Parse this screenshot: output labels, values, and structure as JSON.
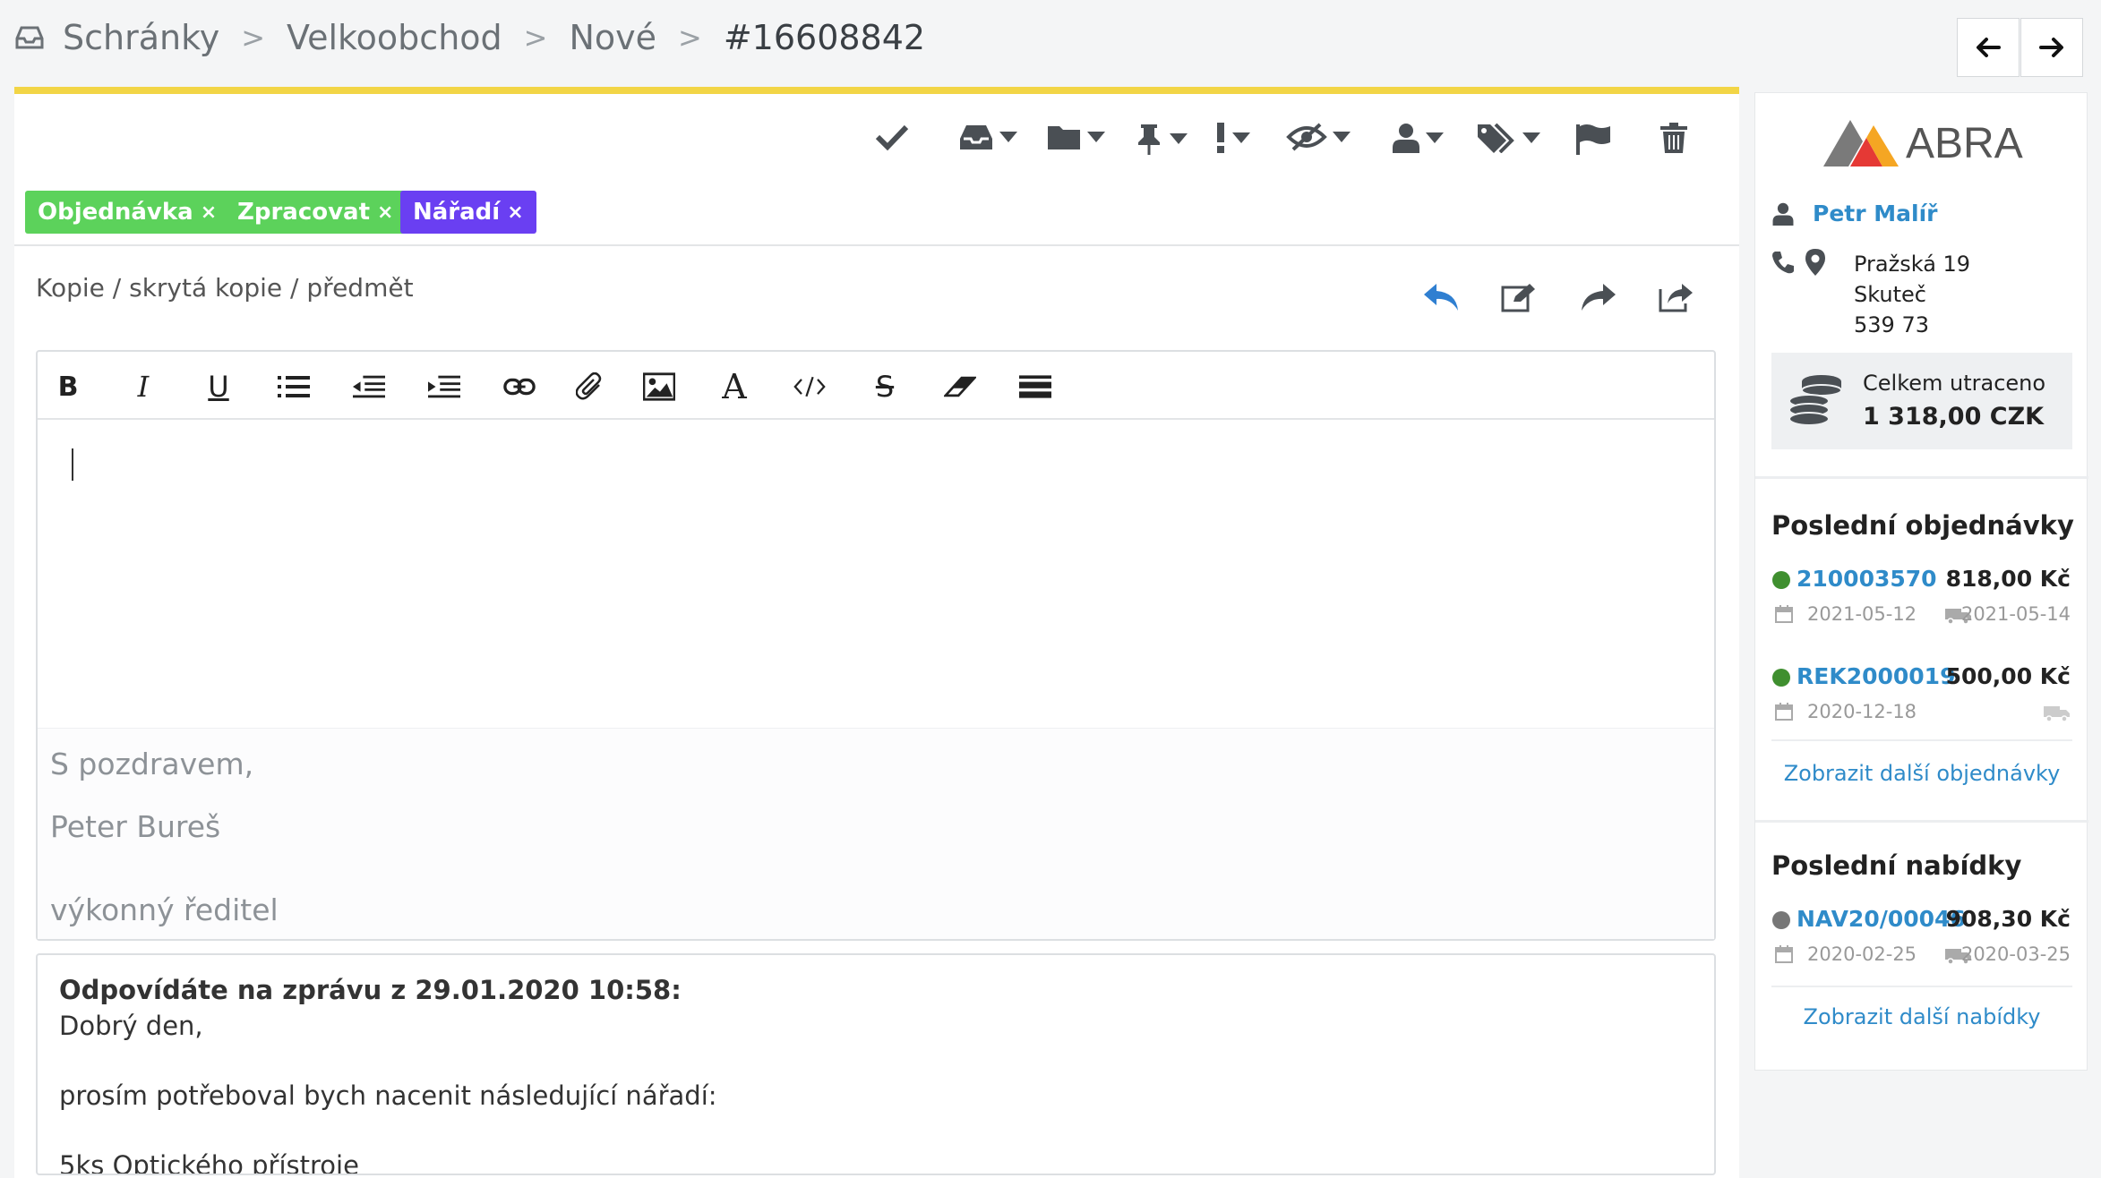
{
  "breadcrumb": {
    "items": [
      "Schránky",
      "Velkoobchod",
      "Nové"
    ],
    "separator": ">",
    "current": "#16608842"
  },
  "navigation": {
    "prev_icon": "arrow-left-icon",
    "next_icon": "arrow-right-icon"
  },
  "toolbar": {
    "icons": [
      "check-icon",
      "inbox-icon",
      "folder-icon",
      "pin-icon",
      "priority-icon",
      "visibility-icon",
      "user-icon",
      "tags-icon",
      "flag-icon",
      "trash-icon"
    ]
  },
  "tags": [
    {
      "label": "Objednávka",
      "color": "#5cd25b"
    },
    {
      "label": "Zpracovat",
      "color": "#5cd25b"
    },
    {
      "label": "Nářadí",
      "color": "#6a3ff2"
    }
  ],
  "tag_remove_symbol": "×",
  "compose": {
    "cc_link": "Kopie / skrytá kopie / předmět",
    "actions": [
      "reply-icon",
      "edit-icon",
      "forward-icon",
      "share-icon"
    ],
    "format_bar": [
      "bold",
      "italic",
      "underline",
      "list",
      "outdent",
      "indent",
      "link",
      "attachment",
      "image",
      "font",
      "code",
      "strikethrough",
      "eraser",
      "horizontal-rule"
    ],
    "signature": [
      "S pozdravem,",
      "Peter Bureš",
      "výkonný ředitel"
    ]
  },
  "quoted": {
    "header": "Odpovídáte na zprávu z 29.01.2020 10:58:",
    "lines": [
      "Dobrý den,",
      "prosím potřeboval bych nacenit následující nářadí:",
      "5ks Optického přístroje"
    ]
  },
  "sidebar": {
    "brand": "ABRA",
    "contact": {
      "name": "Petr Malíř",
      "address": [
        "Pražská 19",
        "Skuteč",
        "539 73"
      ]
    },
    "spent": {
      "label": "Celkem utraceno",
      "value": "1 318,00 CZK"
    },
    "orders": {
      "title": "Poslední objednávky",
      "items": [
        {
          "id": "210003570",
          "amount": "818,00 Kč",
          "date": "2021-05-12",
          "delivery": "2021-05-14",
          "status_color": "#3f8f2f"
        },
        {
          "id": "REK2000019",
          "amount": "500,00 Kč",
          "date": "2020-12-18",
          "delivery": "",
          "status_color": "#3f8f2f"
        }
      ],
      "more_link": "Zobrazit další objednávky"
    },
    "offers": {
      "title": "Poslední nabídky",
      "items": [
        {
          "id": "NAV20/00046",
          "amount": "908,30 Kč",
          "date": "2020-02-25",
          "delivery": "2020-03-25",
          "status_color": "#777777"
        }
      ],
      "more_link": "Zobrazit další nabídky"
    }
  }
}
